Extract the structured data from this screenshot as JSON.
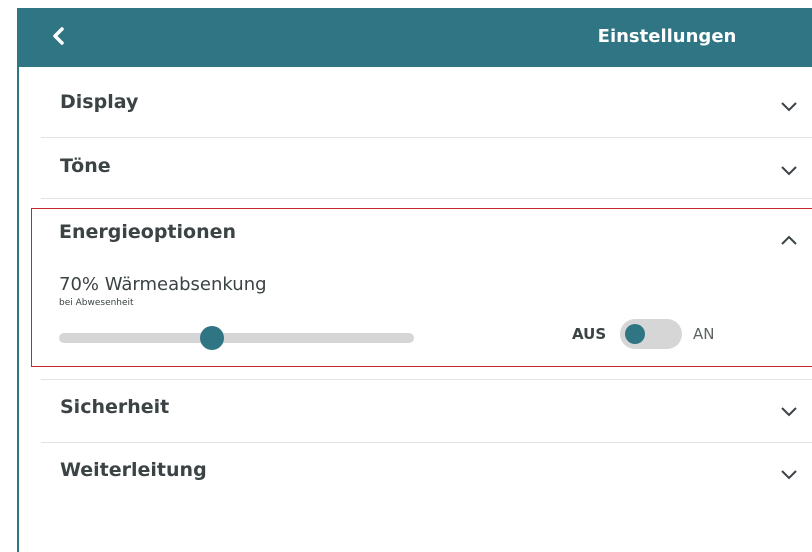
{
  "header": {
    "title": "Einstellungen",
    "back_icon": "chevron-left-icon",
    "background": "#2f7584"
  },
  "sections": [
    {
      "label": "Display",
      "expanded": false
    },
    {
      "label": "Töne",
      "expanded": false
    },
    {
      "label": "Energieoptionen",
      "expanded": true
    },
    {
      "label": "Sicherheit",
      "expanded": false
    },
    {
      "label": "Weiterleitung",
      "expanded": false
    }
  ],
  "energy": {
    "setting_title": "70% Wärmeabsenkung",
    "setting_subtitle": "bei Abwesenheit",
    "slider_fraction": 0.43,
    "toggle_off_label": "AUS",
    "toggle_on_label": "AN",
    "toggle_state": "AUS"
  },
  "colors": {
    "accent": "#2f7584",
    "highlight_border": "#c8262c",
    "text": "#3b4345"
  }
}
